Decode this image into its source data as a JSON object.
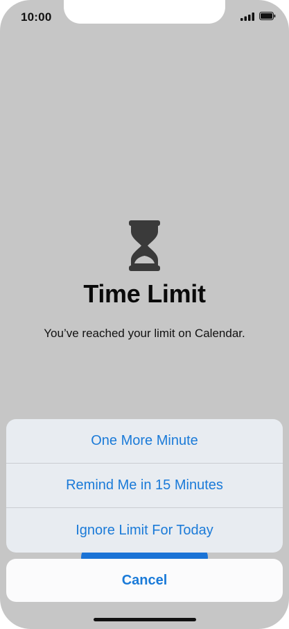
{
  "status_bar": {
    "time": "10:00",
    "icons": [
      "cellular-signal-icon",
      "battery-icon"
    ]
  },
  "screen": {
    "icon": "hourglass-icon",
    "title": "Time Limit",
    "message": "You’ve reached your limit on Calendar."
  },
  "action_sheet": {
    "options": [
      {
        "label": "One More Minute"
      },
      {
        "label": "Remind Me in 15 Minutes"
      },
      {
        "label": "Ignore Limit For Today"
      }
    ],
    "cancel_label": "Cancel"
  },
  "colors": {
    "accent": "#1a7ad8",
    "backdrop": "#c6c6c6",
    "sheet_background": "#e8ecf1"
  }
}
